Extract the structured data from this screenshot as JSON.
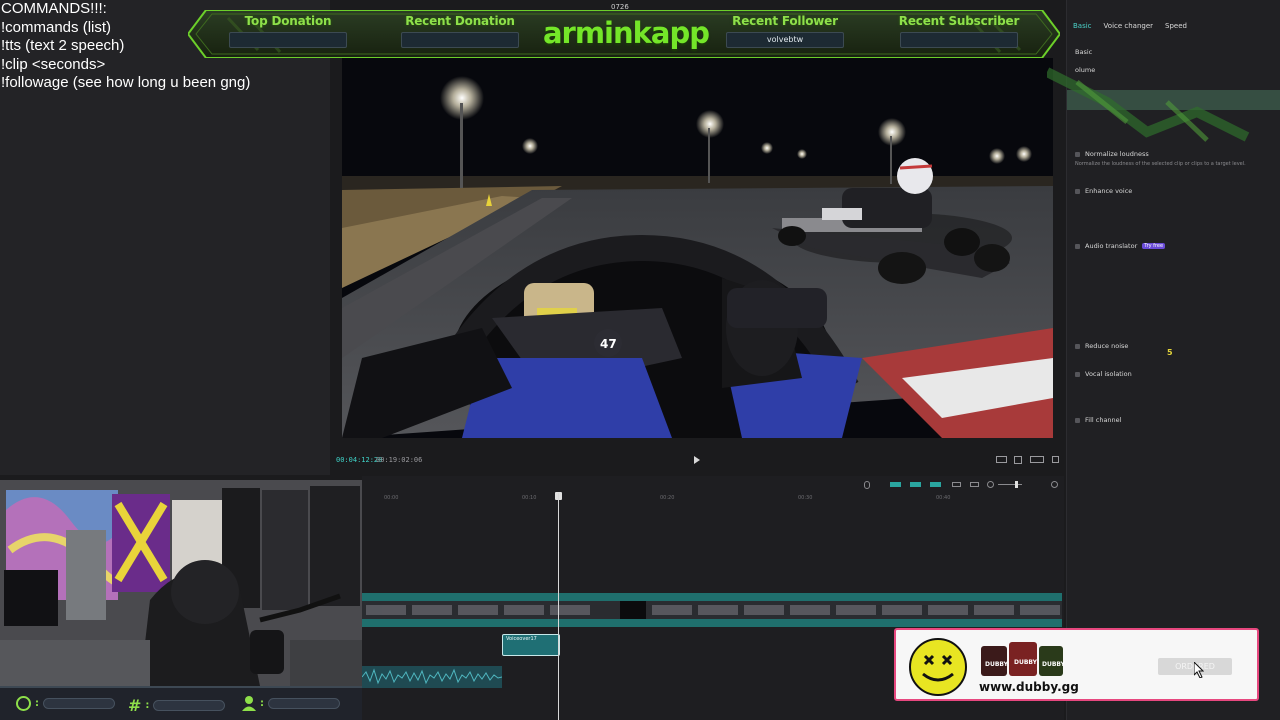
{
  "commands": {
    "title": "COMMANDS!!!:",
    "lines": [
      "!commands (list)",
      "!tts (text 2 speech)",
      "!clip <seconds>",
      "!followage (see how long u been gng)"
    ]
  },
  "top_time": "0726",
  "banner": {
    "top_donation": {
      "label": "Top Donation",
      "value": ""
    },
    "recent_donation": {
      "label": "Recent Donation",
      "value": ""
    },
    "streamer": "arminkapp",
    "recent_follower": {
      "label": "Recent Follower",
      "value": "volvebtw"
    },
    "recent_subscriber": {
      "label": "Recent Subscriber",
      "value": ""
    }
  },
  "preview": {
    "current_time": "00:04:12:20",
    "total_time": "00:19:02:06",
    "kart_number": "47"
  },
  "right_panel": {
    "tabs": [
      "Basic",
      "Voice changer",
      "Speed"
    ],
    "section": "Basic",
    "volume_label": "olume",
    "normalize": {
      "label": "Normalize loudness",
      "desc": "Normalize the loudness of the selected clip or clips to a target level."
    },
    "enhance": {
      "label": "Enhance voice"
    },
    "translator": {
      "label": "Audio translator",
      "badge": "Try free"
    },
    "reduce_noise": {
      "label": "Reduce noise"
    },
    "vocal_isolation": {
      "label": "Vocal isolation"
    },
    "fill_channel": {
      "label": "Fill channel"
    },
    "marker_value": "5"
  },
  "timeline": {
    "ruler": [
      "00:00",
      "00:10",
      "00:20",
      "00:30",
      "00:40"
    ],
    "voiceover_clip": "Voiceover17"
  },
  "ad": {
    "url": "www.dubby.gg",
    "button": "ORDERED",
    "product_label": "DUBBY"
  },
  "colors": {
    "accent_green": "#74e629",
    "timeline_teal": "#1f6f6d",
    "ad_border": "#e7487f"
  }
}
